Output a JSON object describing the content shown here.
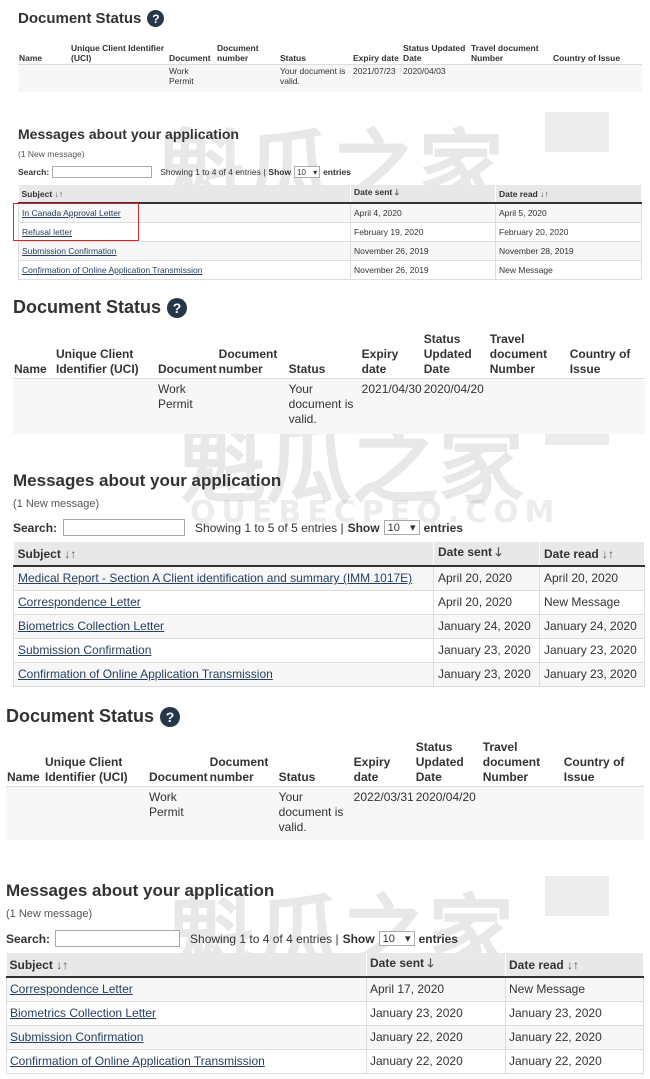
{
  "watermark": {
    "cn_text": "魁瓜之家",
    "en_text": "QUEBECPEQ.COM",
    "color": "#969696"
  },
  "colors": {
    "help_icon": "#26374a",
    "link": "#284162",
    "highlight_box": "#d9252a"
  },
  "icons": {
    "help": "question-circle-icon",
    "sort_both": "sort-updown-icon",
    "sort_desc": "sort-down-arrow-icon",
    "select_caret": "caret-down-icon"
  },
  "ds_headers": {
    "name": "Name",
    "uci": "Unique Client Identifier (UCI)",
    "document": "Document",
    "document_number": "Document number",
    "status": "Status",
    "expiry_date": "Expiry date",
    "status_updated": "Status Updated Date",
    "travel_doc": "Travel document Number",
    "country": "Country of Issue"
  },
  "msg_headers": {
    "subject": "Subject",
    "date_sent": "Date sent",
    "date_read": "Date read"
  },
  "sort_glyphs": {
    "both": "↓↑",
    "desc": "🡓"
  },
  "common": {
    "ds_title": "Document Status",
    "help_glyph": "?",
    "msg_title": "Messages about your application",
    "search_label": "Search:",
    "show_label": "Show",
    "entries_label": "entries",
    "per_page": "10",
    "caret": "▾"
  },
  "panels": [
    {
      "doc_status": {
        "name": "",
        "uci": "",
        "document": "Work Permit",
        "document_number": "",
        "status": "Your document is valid.",
        "expiry": "2021/07/23",
        "updated": "2020/04/03",
        "travel_doc": "",
        "country": ""
      },
      "new_message": "(1 New message)",
      "showing": "Showing 1 to 4 of 4 entries |",
      "messages": [
        {
          "subject": "In Canada Approval Letter",
          "sent": "April 4, 2020",
          "read": "April 5, 2020"
        },
        {
          "subject": "Refusal letter",
          "sent": "February 19, 2020",
          "read": "February 20, 2020"
        },
        {
          "subject": "Submission Confirmation",
          "sent": "November 26, 2019",
          "read": "November 28, 2019"
        },
        {
          "subject": "Confirmation of Online Application Transmission",
          "sent": "November 26, 2019",
          "read": "New Message"
        }
      ]
    },
    {
      "doc_status": {
        "name": "",
        "uci": "",
        "document": "Work Permit",
        "document_number": "",
        "status": "Your document is valid.",
        "expiry": "2021/04/30",
        "updated": "2020/04/20",
        "travel_doc": "",
        "country": ""
      },
      "new_message": "(1 New message)",
      "showing": "Showing 1 to 5 of 5 entries |",
      "messages": [
        {
          "subject": "Medical Report - Section A Client identification and summary (IMM 1017E)",
          "sent": "April 20, 2020",
          "read": "April 20, 2020"
        },
        {
          "subject": "Correspondence Letter",
          "sent": "April 20, 2020",
          "read": "New Message"
        },
        {
          "subject": "Biometrics Collection Letter",
          "sent": "January 24, 2020",
          "read": "January 24, 2020"
        },
        {
          "subject": "Submission Confirmation",
          "sent": "January 23, 2020",
          "read": "January 23, 2020"
        },
        {
          "subject": "Confirmation of Online Application Transmission",
          "sent": "January 23, 2020",
          "read": "January 23, 2020"
        }
      ]
    },
    {
      "doc_status": {
        "name": "",
        "uci": "",
        "document": "Work Permit",
        "document_number": "",
        "status": "Your document is valid.",
        "expiry": "2022/03/31",
        "updated": "2020/04/20",
        "travel_doc": "",
        "country": ""
      },
      "new_message": "(1 New message)",
      "showing": "Showing 1 to 4 of 4 entries |",
      "messages": [
        {
          "subject": "Correspondence Letter",
          "sent": "April 17, 2020",
          "read": "New Message"
        },
        {
          "subject": "Biometrics Collection Letter",
          "sent": "January 23, 2020",
          "read": "January 23, 2020"
        },
        {
          "subject": "Submission Confirmation",
          "sent": "January 22, 2020",
          "read": "January 22, 2020"
        },
        {
          "subject": "Confirmation of Online Application Transmission",
          "sent": "January 22, 2020",
          "read": "January 22, 2020"
        }
      ]
    }
  ]
}
